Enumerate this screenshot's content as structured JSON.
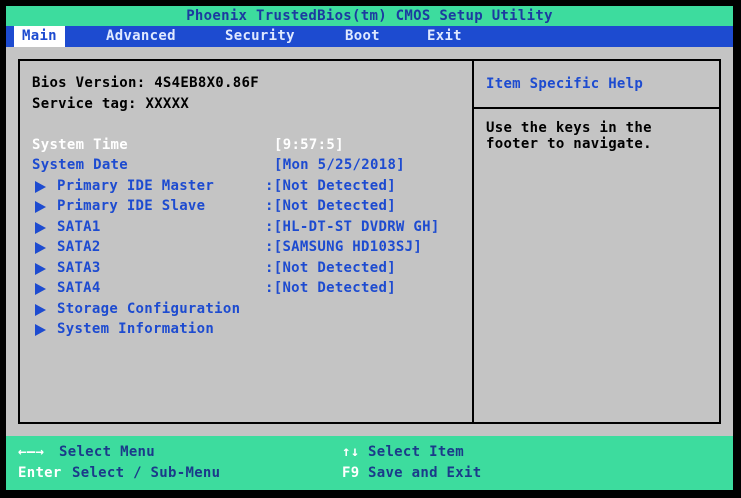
{
  "title": "Phoenix TrustedBios(tm) CMOS Setup Utility",
  "menu": [
    "Main",
    "Advanced",
    "Security",
    "Boot",
    "Exit"
  ],
  "bios_version_label": "Bios Version: 4S4EB8X0.86F",
  "service_tag_label": "Service tag: XXXXX",
  "system_time": {
    "label": "System Time",
    "value": "[9:57:5]"
  },
  "system_date": {
    "label": "System Date",
    "value": "[Mon 5/25/2018]"
  },
  "items": [
    {
      "label": "Primary IDE Master",
      "value": ":[Not Detected]"
    },
    {
      "label": "Primary IDE Slave",
      "value": ":[Not Detected]"
    },
    {
      "label": "SATA1",
      "value": ":[HL-DT-ST DVDRW GH]"
    },
    {
      "label": "SATA2",
      "value": ":[SAMSUNG HD103SJ]"
    },
    {
      "label": "SATA3",
      "value": ":[Not Detected]"
    },
    {
      "label": "SATA4",
      "value": ":[Not Detected]"
    },
    {
      "label": "Storage Configuration",
      "value": ""
    },
    {
      "label": "System Information",
      "value": ""
    }
  ],
  "help": {
    "title": "Item Specific Help",
    "line1": "Use the keys in the",
    "line2": "footer to navigate."
  },
  "footer": {
    "lr_arrows": "←—→",
    "select_menu": "Select Menu",
    "ud_arrows": "↑↓",
    "select_item": "Select Item",
    "enter_key": "Enter",
    "enter_action": "Select / Sub-Menu",
    "f9_key": "F9",
    "f9_action": "Save and Exit"
  },
  "colors": {
    "menubar": "#1d4bd0",
    "title_bg": "#3ddc9e",
    "main_bg": "#c4c4c4",
    "text_blue": "#1d4bd0"
  }
}
